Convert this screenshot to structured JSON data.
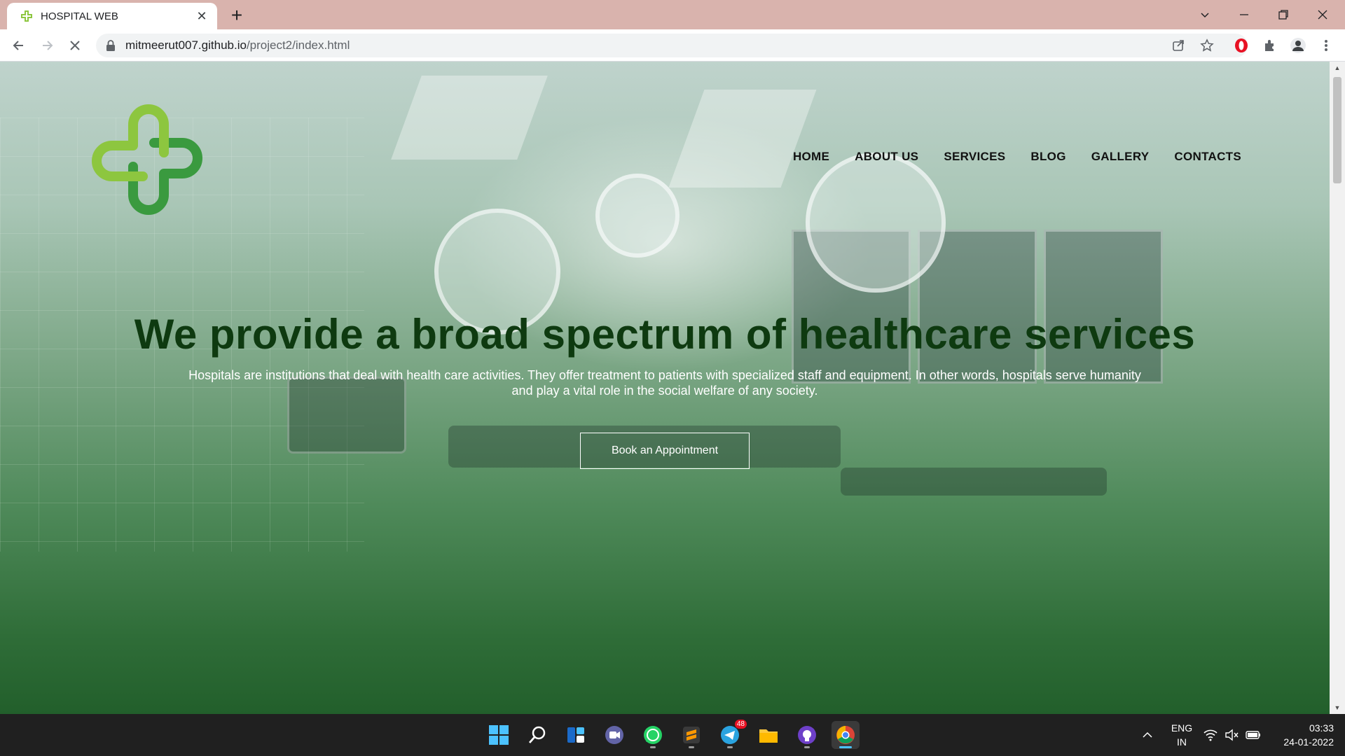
{
  "browser": {
    "tab_title": "HOSPITAL WEB",
    "new_tab_symbol": "+",
    "close_symbol": "✕",
    "url_host": "mitmeerut007.github.io",
    "url_path": "/project2/index.html"
  },
  "site": {
    "nav": [
      "HOME",
      "ABOUT US",
      "SERVICES",
      "BLOG",
      "GALLERY",
      "CONTACTS"
    ],
    "hero_title": "We provide a broad spectrum of healthcare services",
    "hero_text_line1": "Hospitals are institutions that deal with health care activities. They offer treatment to patients with specialized staff and equipment. In other words, hospitals serve humanity",
    "hero_text_line2": "and play a vital role in the social welfare of any society.",
    "cta_label": "Book an Appointment",
    "logo_colors": {
      "light": "#8dc63f",
      "dark": "#3a9a3f"
    }
  },
  "taskbar": {
    "telegram_badge": "48",
    "lang_line1": "ENG",
    "lang_line2": "IN",
    "time": "03:33",
    "date": "24-01-2022"
  },
  "colors": {
    "tab_strip": "#d9b3ad",
    "hero_title": "#0e3a10",
    "taskbar": "#202020",
    "accent": "#4cc2ff"
  }
}
